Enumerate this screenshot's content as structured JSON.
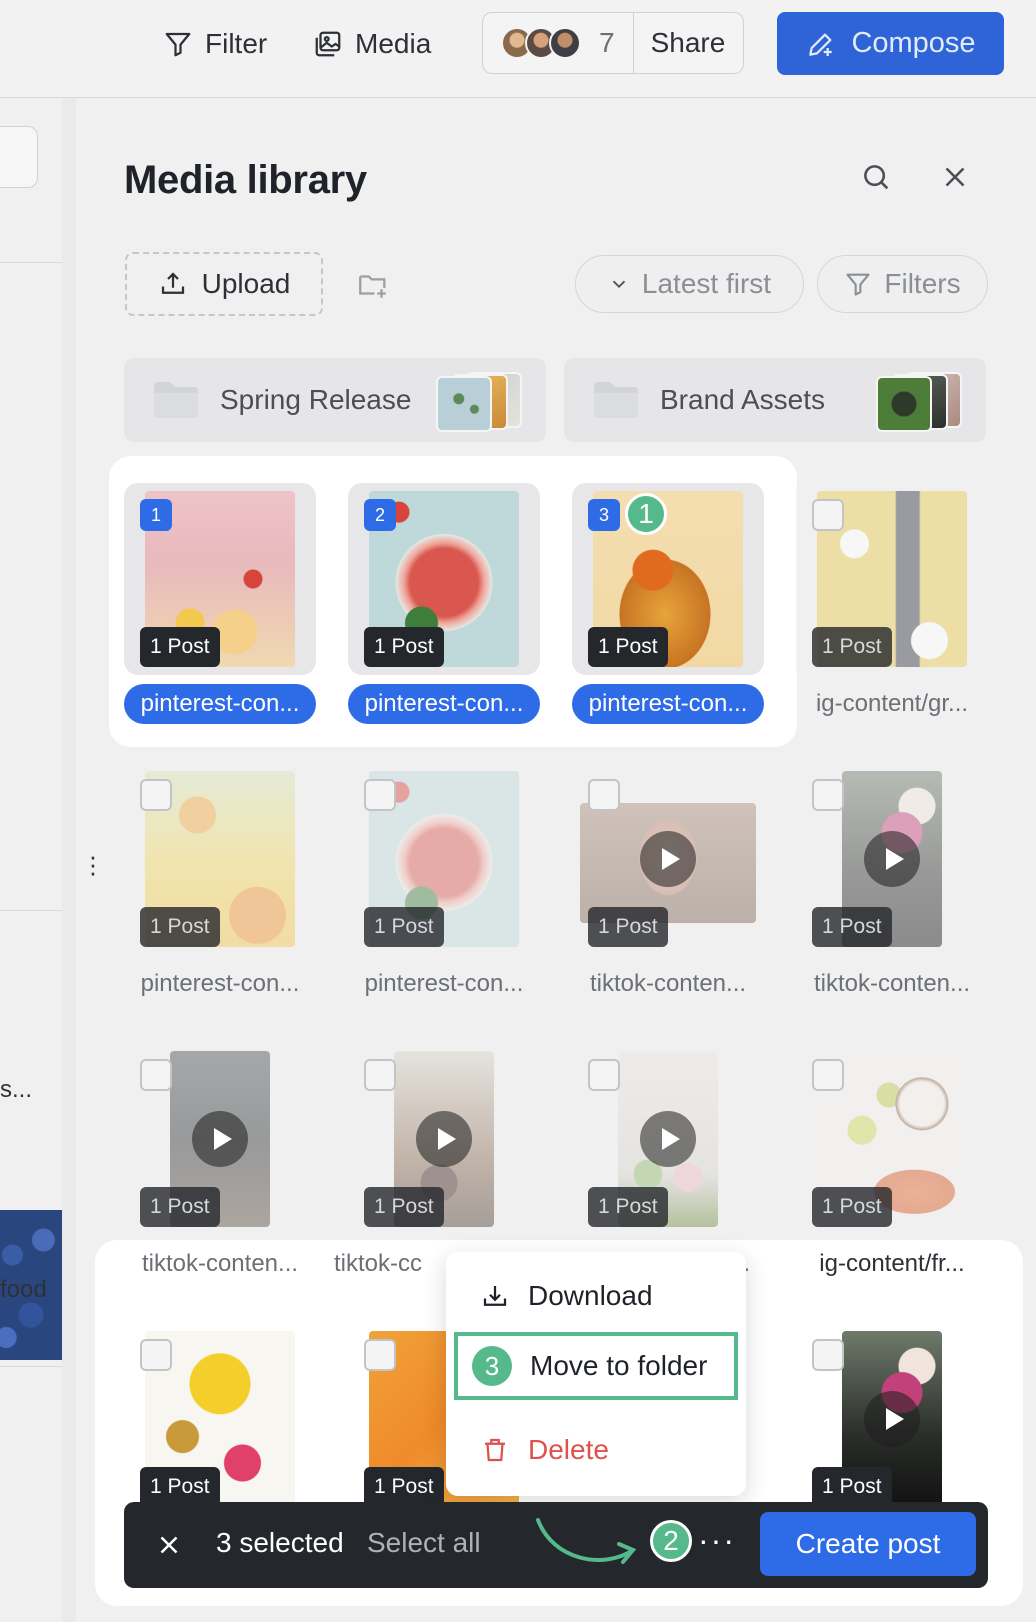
{
  "topbar": {
    "filter_label": "Filter",
    "media_label": "Media",
    "collaborator_count": "7",
    "share_label": "Share",
    "compose_label": "Compose"
  },
  "sidebar": {
    "snippet_1": "s...",
    "snippet_2": "food"
  },
  "library": {
    "title": "Media library",
    "upload_label": "Upload",
    "sort_label": "Latest first",
    "filters_label": "Filters",
    "folders": [
      {
        "name": "Spring Release"
      },
      {
        "name": "Brand Assets"
      }
    ],
    "items": [
      {
        "name": "pinterest-con...",
        "posts": "1 Post",
        "selected": true,
        "order": "1"
      },
      {
        "name": "pinterest-con...",
        "posts": "1 Post",
        "selected": true,
        "order": "2"
      },
      {
        "name": "pinterest-con...",
        "posts": "1 Post",
        "selected": true,
        "order": "3"
      },
      {
        "name": "ig-content/gr...",
        "posts": "1 Post",
        "selected": false
      },
      {
        "name": "pinterest-con...",
        "posts": "1 Post",
        "selected": false
      },
      {
        "name": "pinterest-con...",
        "posts": "1 Post",
        "selected": false
      },
      {
        "name": "tiktok-conten...",
        "posts": "1 Post",
        "selected": false,
        "video": true
      },
      {
        "name": "tiktok-conten...",
        "posts": "1 Post",
        "selected": false,
        "video": true
      },
      {
        "name": "tiktok-conten...",
        "posts": "1 Post",
        "selected": false,
        "video": true
      },
      {
        "name": "tiktok-cc",
        "posts": "1 Post",
        "selected": false,
        "video": true
      },
      {
        "name": "...",
        "posts": "1 Post",
        "selected": false,
        "video": true
      },
      {
        "name": "ig-content/fr...",
        "posts": "1 Post",
        "selected": false
      },
      {
        "name": "",
        "posts": "1 Post",
        "selected": false
      },
      {
        "name": "",
        "posts": "1 Post",
        "selected": false
      },
      {
        "name": "",
        "posts": "1 Post",
        "selected": false,
        "video": true
      }
    ]
  },
  "menu": {
    "download_label": "Download",
    "move_label": "Move to folder",
    "delete_label": "Delete"
  },
  "actionbar": {
    "selected_label": "3 selected",
    "select_all_label": "Select all",
    "more_label": "···",
    "create_post_label": "Create post"
  },
  "callouts": {
    "step1": "1",
    "step2": "2",
    "step3": "3"
  },
  "colors": {
    "accent": "#2e6be6",
    "compose": "#2e64d7",
    "callout": "#56b98b",
    "danger": "#e0504c",
    "actionbar": "#24272c"
  }
}
